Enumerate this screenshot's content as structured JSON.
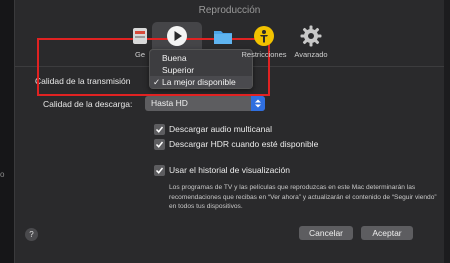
{
  "window": {
    "title": "Reproducción"
  },
  "background_fragments": [
    "",
    "o"
  ],
  "toolbar": {
    "items": [
      {
        "label": "Ge",
        "icon": "general-icon"
      },
      {
        "label": "",
        "icon": "play-icon",
        "selected": true
      },
      {
        "label": "",
        "icon": "folder-icon"
      },
      {
        "label": "Restricciones",
        "icon": "restrictions-icon"
      },
      {
        "label": "Avanzado",
        "icon": "gear-icon"
      }
    ]
  },
  "streaming": {
    "label": "Calidad de la transmisión",
    "selected": "La mejor disponible",
    "options": [
      {
        "label": "Buena",
        "checked": false
      },
      {
        "label": "Superior",
        "checked": false
      },
      {
        "label": "La mejor disponible",
        "checked": true
      }
    ],
    "check_glyph": "✓"
  },
  "download": {
    "label": "Calidad de la descarga:",
    "value": "Hasta HD"
  },
  "checkboxes": [
    {
      "label": "Descargar audio multicanal",
      "checked": true
    },
    {
      "label": "Descargar HDR cuando esté disponible",
      "checked": true
    },
    {
      "label": "Usar el historial de visualización",
      "checked": true
    }
  ],
  "description": "Los programas de TV y las películas que reproduzcas en este Mac determinarán las recomendaciones que recibas en “Ver ahora” y actualizarán el contenido de “Seguir viendo” en todos tus dispositivos.",
  "help": {
    "label": "?"
  },
  "buttons": {
    "cancel": "Cancelar",
    "accept": "Aceptar"
  },
  "colors": {
    "accent": "#2f6fe0",
    "highlight_box": "#e02222",
    "window_bg": "#2a2a2c"
  }
}
